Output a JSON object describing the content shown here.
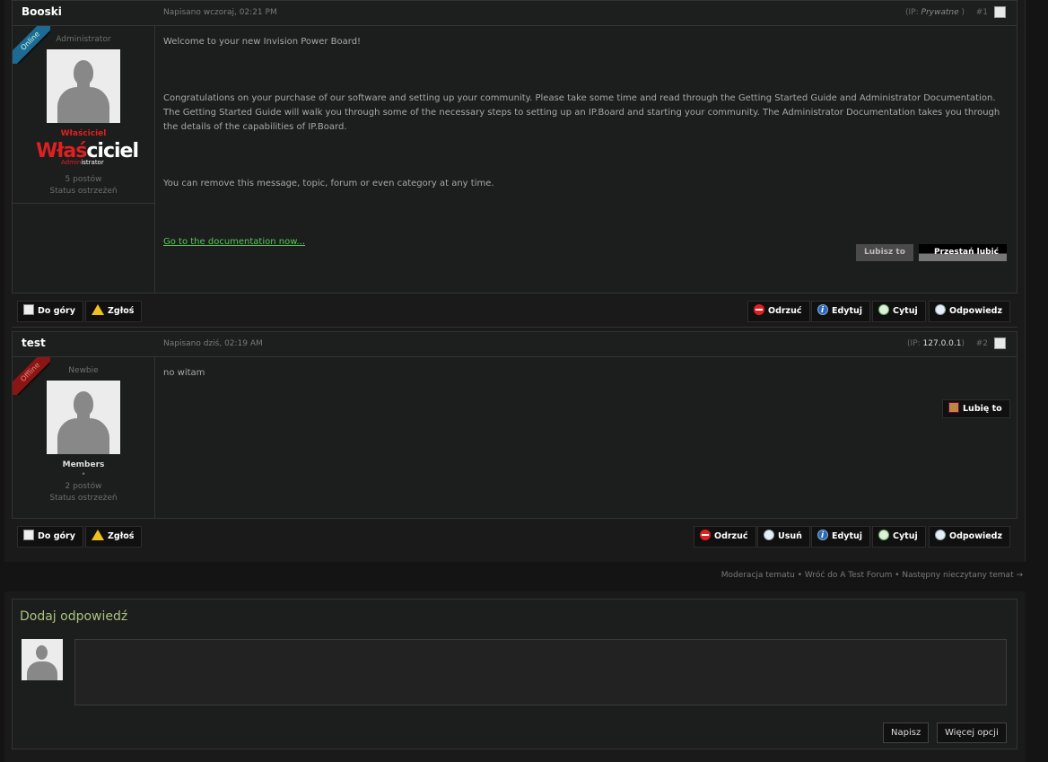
{
  "posts": [
    {
      "author": "Booski",
      "date": "Napisano wczoraj, 02:21 PM",
      "ip_prefix": "(IP: ",
      "ip_value": "Prywatne",
      "ip_suffix": " )",
      "number": "#1",
      "status": "Online",
      "rank": "Administrator",
      "group_name": "Właściciel",
      "group_image_red": "Właś",
      "group_image_white": "ciciel",
      "group_image_small_red": "Admin",
      "group_image_small_white": "istrator",
      "posts_count": "5 postów",
      "warn_status": "Status ostrzeżeń",
      "paragraphs": [
        "Welcome to your new Invision Power Board!",
        "Congratulations on your purchase of our software and setting up your community. Please take some time and read through the Getting Started Guide and Administrator Documentation. The Getting Started Guide will walk you through some of the necessary steps to setting up an IP.Board and starting your community. The Administrator Documentation takes you through the details of the capabilities of IP.Board.",
        "You can remove this message, topic, forum or even category at any time."
      ],
      "link": "Go to the documentation now...",
      "like_label": "Lubisz to",
      "unlike_label": "Przestań lubić"
    },
    {
      "author": "test",
      "date": "Napisano dziś, 02:19 AM",
      "ip_prefix": "(IP: ",
      "ip_value": "127.0.0.1",
      "ip_suffix": ")",
      "number": "#2",
      "status": "Offline",
      "rank": "Newbie",
      "group_name": "Members",
      "dot": "•",
      "posts_count": "2 postów",
      "warn_status": "Status ostrzeżeń",
      "text": "no witam",
      "like_label": "Lubię to"
    }
  ],
  "buttons": {
    "top": "Do góry",
    "report": "Zgłoś",
    "reject": "Odrzuć",
    "delete": "Usuń",
    "edit": "Edytuj",
    "quote": "Cytuj",
    "reply": "Odpowiedz"
  },
  "footer_links": "Moderacja tematu • Wróć do A Test Forum • Następny nieczytany temat →",
  "reply_box": {
    "title": "Dodaj odpowiedź",
    "submit": "Napisz",
    "more": "Więcej opcji"
  },
  "colors": {
    "online": "#1d6a93",
    "offline": "#8a1515",
    "link": "#55c855",
    "reply_title": "#a9c47e"
  }
}
